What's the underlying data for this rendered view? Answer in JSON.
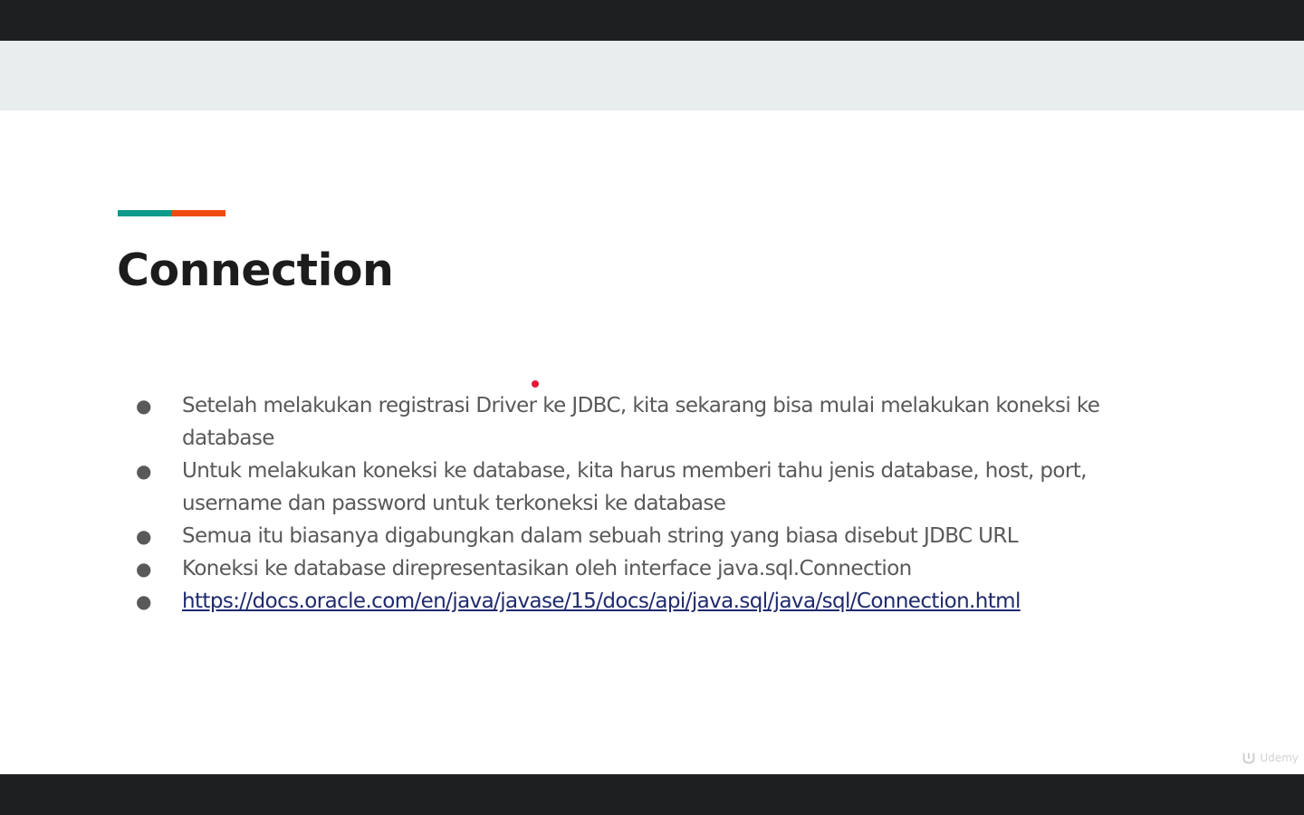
{
  "slide": {
    "title": "Connection",
    "bullets": [
      {
        "text": "Setelah melakukan registrasi Driver ke JDBC, kita sekarang bisa mulai melakukan koneksi ke database"
      },
      {
        "text": "Untuk melakukan koneksi ke database, kita harus memberi tahu jenis database, host, port, username dan password untuk terkoneksi ke database"
      },
      {
        "text": "Semua itu biasanya digabungkan dalam sebuah string yang biasa disebut JDBC URL"
      },
      {
        "text": "Koneksi ke database direpresentasikan oleh interface java.sql.Connection"
      },
      {
        "link": "https://docs.oracle.com/en/java/javase/15/docs/api/java.sql/java/sql/Connection.html"
      }
    ],
    "bullet_symbol": "●"
  },
  "watermark": {
    "icon": "udemy-logo-icon",
    "text": "Udemy"
  },
  "colors": {
    "accent_teal": "#0e9a8a",
    "accent_orange": "#ee4b11",
    "pointer": "#e8173b",
    "link": "#1f2a6e"
  }
}
